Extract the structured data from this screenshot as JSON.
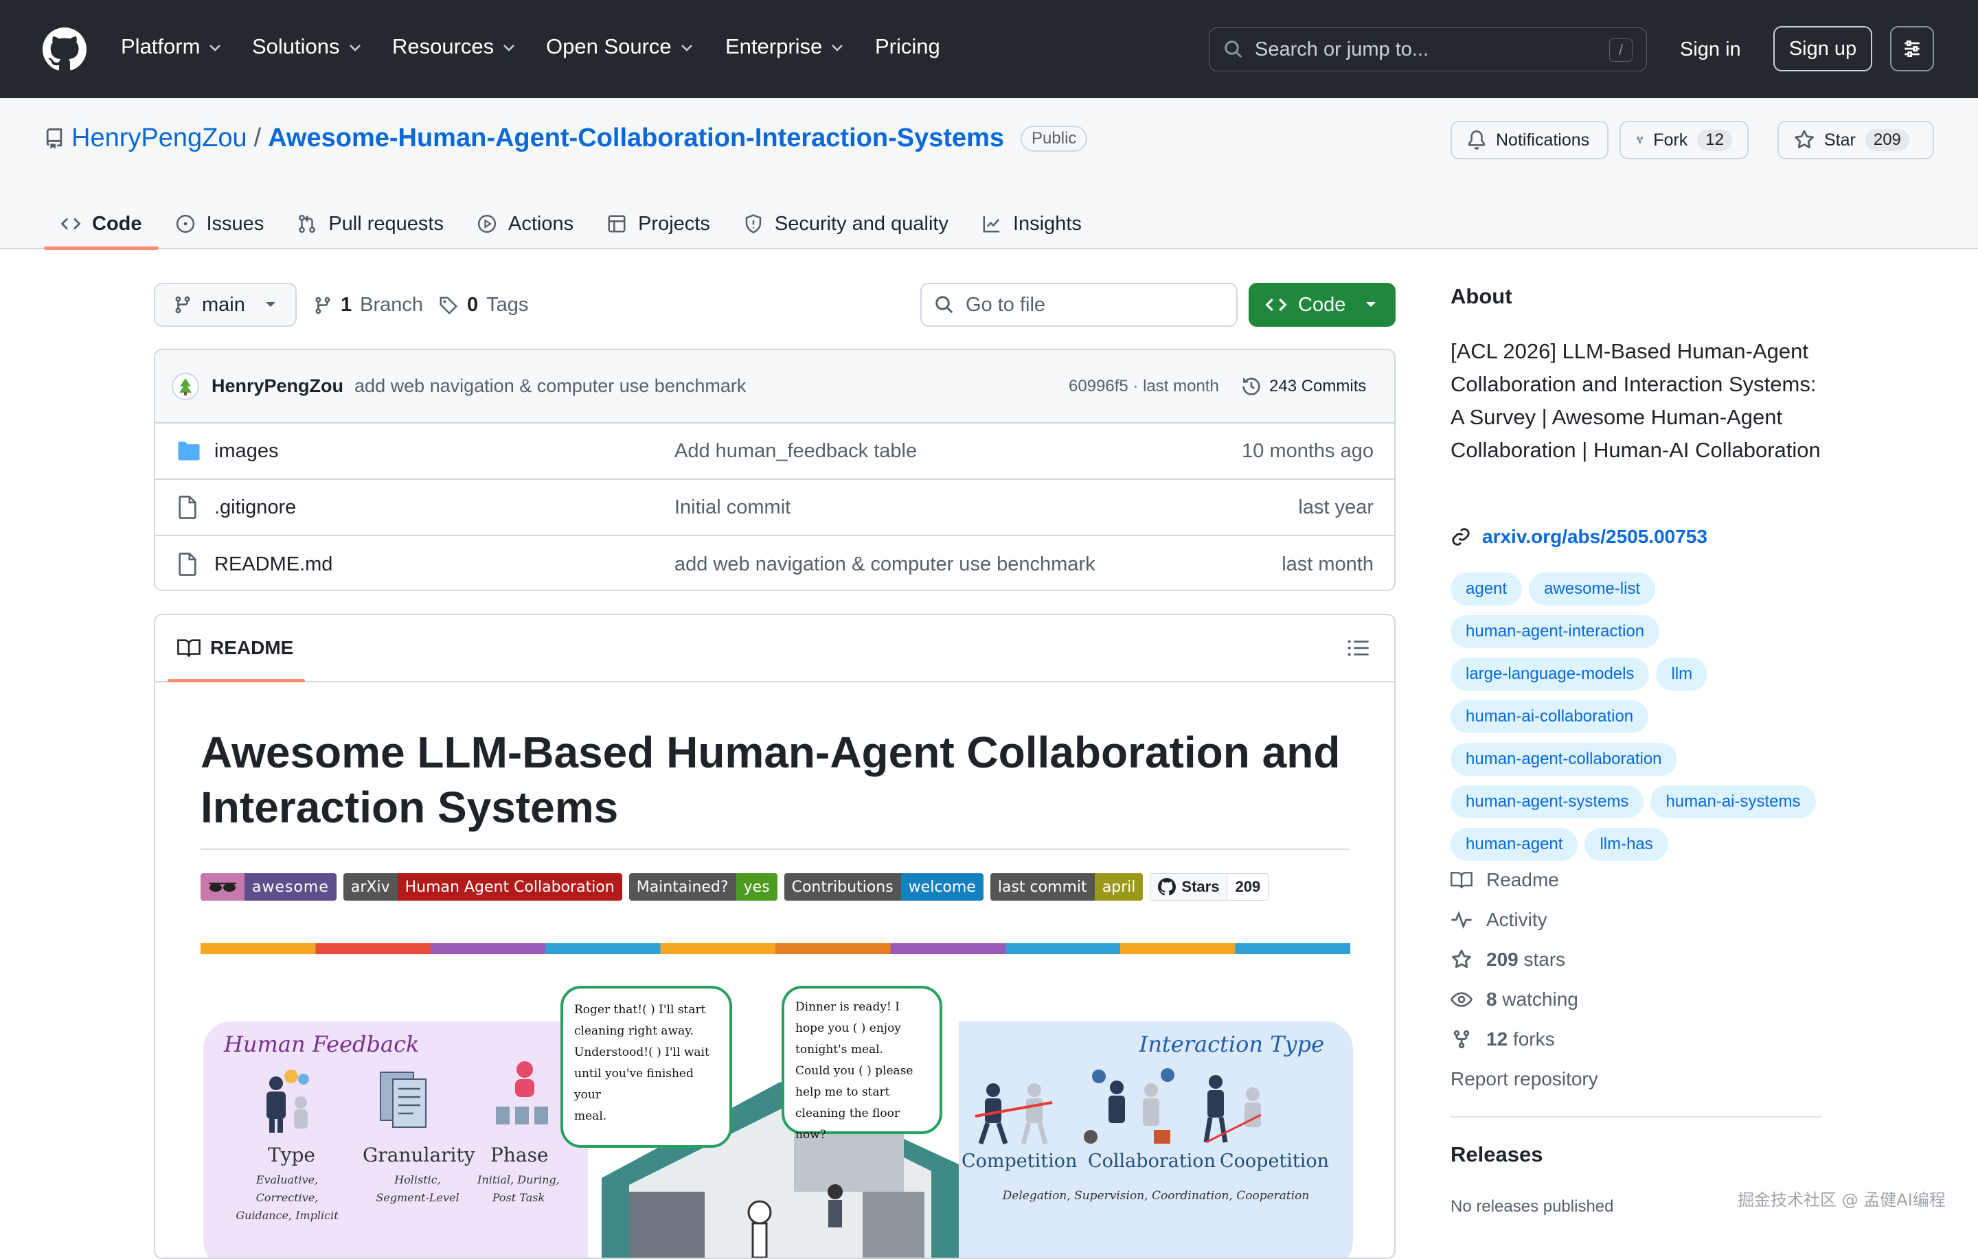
{
  "nav": {
    "items": [
      "Platform",
      "Solutions",
      "Resources",
      "Open Source",
      "Enterprise",
      "Pricing"
    ],
    "search_placeholder": "Search or jump to...",
    "search_shortcut": "/",
    "signin": "Sign in",
    "signup": "Sign up"
  },
  "repo": {
    "owner": "HenryPengZou",
    "separator": "/",
    "name": "Awesome-Human-Agent-Collaboration-Interaction-Systems",
    "visibility": "Public",
    "notifications": "Notifications",
    "fork_label": "Fork",
    "fork_count": "12",
    "star_label": "Star",
    "star_count": "209"
  },
  "tabs": [
    "Code",
    "Issues",
    "Pull requests",
    "Actions",
    "Projects",
    "Security and quality",
    "Insights"
  ],
  "toolbar": {
    "branch": "main",
    "branch_count": "1",
    "branch_label": "Branch",
    "tag_count": "0",
    "tag_label": "Tags",
    "goto_placeholder": "Go to file",
    "code_button": "Code"
  },
  "commit": {
    "author": "HenryPengZou",
    "message": "add web navigation & computer use benchmark",
    "hash": "60996f5",
    "time": "· last month",
    "count_label": "243 Commits"
  },
  "files": [
    {
      "name": "images",
      "type": "folder",
      "message": "Add human_feedback table",
      "time": "10 months ago"
    },
    {
      "name": ".gitignore",
      "type": "file",
      "message": "Initial commit",
      "time": "last year"
    },
    {
      "name": "README.md",
      "type": "file",
      "message": "add web navigation & computer use benchmark",
      "time": "last month"
    }
  ],
  "readme": {
    "label": "README",
    "title": "Awesome LLM-Based Human-Agent Collaboration and Interaction Systems",
    "badges": [
      {
        "left": "awesome",
        "right": "",
        "color": "#5d4f8b"
      },
      {
        "left": "arXiv",
        "right": "Human Agent Collaboration",
        "color": "#b31b1b"
      },
      {
        "left": "Maintained?",
        "right": "yes",
        "color": "#4c9b20"
      },
      {
        "left": "Contributions",
        "right": "welcome",
        "color": "#1480c0"
      },
      {
        "left": "last commit",
        "right": "april",
        "color": "#9a9a18"
      },
      {
        "left": "Stars",
        "right": "209",
        "color": "#ffffff"
      }
    ],
    "figure": {
      "left_title": "Human Feedback",
      "left_items": [
        {
          "name": "Type",
          "sub1": "Evaluative, Corrective,",
          "sub2": "Guidance, Implicit"
        },
        {
          "name": "Granularity",
          "sub1": "Holistic,",
          "sub2": "Segment-Level"
        },
        {
          "name": "Phase",
          "sub1": "Initial, During,",
          "sub2": "Post Task"
        }
      ],
      "bubble1": [
        "Roger that!( ) I'll start",
        "cleaning right away.",
        "Understood!( ) I'll wait",
        "until you've finished your",
        "meal."
      ],
      "bubble2": [
        "Dinner is ready! I",
        "hope you ( ) enjoy",
        "tonight's meal.",
        "Could you ( ) please",
        "help me to start",
        "cleaning the floor now?"
      ],
      "right_title": "Interaction Type",
      "right_items": [
        "Competition",
        "Collaboration",
        "Coopetition"
      ],
      "right_sub": "Delegation, Supervision, Coordination, Cooperation"
    }
  },
  "about": {
    "heading": "About",
    "description": "[ACL 2026] LLM-Based Human-Agent Collaboration and Interaction Systems: A Survey | Awesome Human-Agent Collaboration | Human-AI Collaboration",
    "link": "arxiv.org/abs/2505.00753",
    "topics": [
      "agent",
      "awesome-list",
      "human-agent-interaction",
      "large-language-models",
      "llm",
      "human-ai-collaboration",
      "human-agent-collaboration",
      "human-agent-systems",
      "human-ai-systems",
      "human-agent",
      "llm-has"
    ],
    "readme": "Readme",
    "activity": "Activity",
    "stars_num": "209",
    "stars_label": "stars",
    "watching_num": "8",
    "watching_label": "watching",
    "forks_num": "12",
    "forks_label": "forks",
    "report": "Report repository",
    "releases_heading": "Releases",
    "releases_text": "No releases published"
  },
  "watermark": "掘金技术社区 @ 孟健AI编程"
}
